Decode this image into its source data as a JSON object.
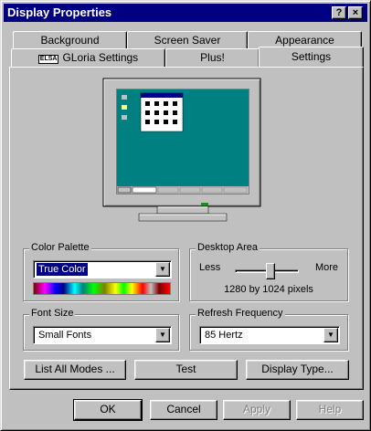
{
  "window": {
    "title": "Display Properties",
    "help_button": "?",
    "close_button": "×"
  },
  "tabs": {
    "row1": [
      "Background",
      "Screen Saver",
      "Appearance"
    ],
    "row2": [
      {
        "label": "GLoria Settings",
        "badge": "ELSA"
      },
      {
        "label": "Plus!"
      },
      {
        "label": "Settings",
        "active": true
      }
    ]
  },
  "monitor": {
    "desktop_color": "#008080",
    "icon": "monitor-preview-icon"
  },
  "color_palette": {
    "label": "Color Palette",
    "value": "True Color"
  },
  "desktop_area": {
    "label": "Desktop Area",
    "less": "Less",
    "more": "More",
    "resolution": "1280 by 1024 pixels",
    "slider_position": 0.55
  },
  "font_size": {
    "label": "Font Size",
    "value": "Small Fonts"
  },
  "refresh_frequency": {
    "label": "Refresh Frequency",
    "value": "85 Hertz"
  },
  "buttons": {
    "list_all_modes": "List All Modes ...",
    "test": "Test",
    "display_type": "Display Type..."
  },
  "footer": {
    "ok": "OK",
    "cancel": "Cancel",
    "apply": "Apply",
    "help": "Help"
  }
}
